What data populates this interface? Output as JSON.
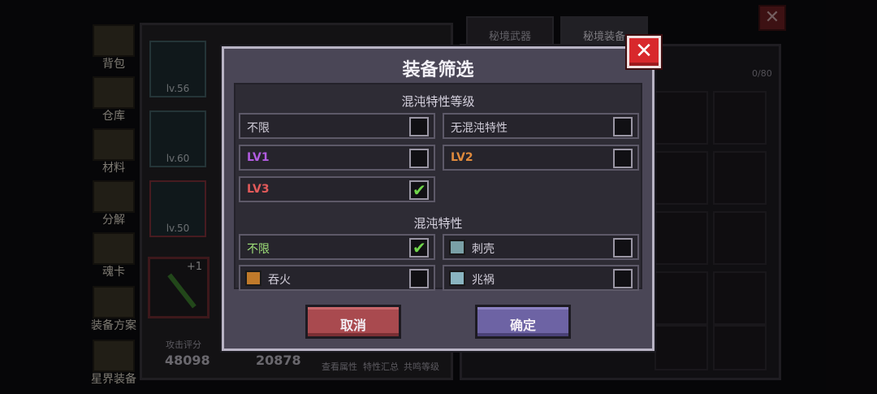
{
  "sidebar": {
    "items": [
      {
        "label": "背包"
      },
      {
        "label": "仓库"
      },
      {
        "label": "材料"
      },
      {
        "label": "分解"
      },
      {
        "label": "魂卡"
      },
      {
        "label": "装备方案"
      },
      {
        "label": "星界装备"
      }
    ]
  },
  "inventory": {
    "slots": [
      {
        "level": "lv.56"
      },
      {
        "level": "lv.60"
      },
      {
        "level": "lv.50"
      }
    ],
    "weapon_plus": "+1"
  },
  "stats": {
    "attack_label": "攻击评分",
    "attack_value": "48098",
    "defense_value": "20878",
    "buttons": [
      "查看属性",
      "特性汇总",
      "共鸣等级"
    ]
  },
  "tabs": [
    {
      "label": "秘境武器"
    },
    {
      "label": "秘境装备"
    }
  ],
  "storage_count": "0/80",
  "dialog": {
    "title": "装备筛选",
    "section1_title": "混沌特性等级",
    "level_options": [
      {
        "label": "不限",
        "checked": false
      },
      {
        "label": "无混沌特性",
        "checked": false
      },
      {
        "label": "LV1",
        "checked": false
      },
      {
        "label": "LV2",
        "checked": false
      },
      {
        "label": "LV3",
        "checked": true
      }
    ],
    "section2_title": "混沌特性",
    "trait_options": [
      {
        "label": "不限",
        "checked": true
      },
      {
        "label": "刺壳",
        "icon": "thorn-shell-icon",
        "checked": false
      },
      {
        "label": "吞火",
        "icon": "fire-eater-icon",
        "checked": false
      },
      {
        "label": "兆祸",
        "icon": "omen-icon",
        "checked": false
      }
    ],
    "cancel_label": "取消",
    "confirm_label": "确定"
  },
  "colors": {
    "lv1": "#b25ce0",
    "lv2": "#e08a3c",
    "lv3": "#e25a5a",
    "check": "#6fd54a",
    "cancel_button": "#a94a4f",
    "confirm_button": "#6d63a4",
    "close_button": "#d8282c"
  }
}
